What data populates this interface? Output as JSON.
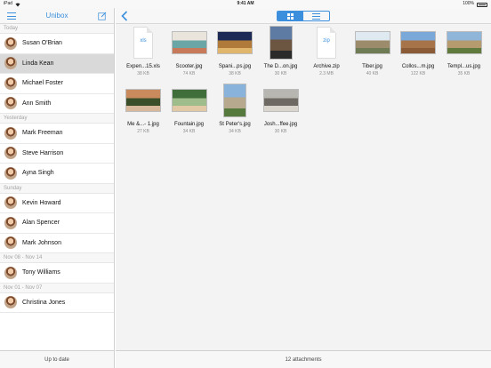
{
  "status_bar": {
    "device": "iPad",
    "time": "9:41 AM",
    "battery": "100%"
  },
  "sidebar": {
    "title": "Unibox",
    "footer": "Up to date",
    "sections": [
      {
        "header": "Today",
        "contacts": [
          {
            "name": "Susan O'Brian",
            "selected": false
          },
          {
            "name": "Linda Kean",
            "selected": true
          },
          {
            "name": "Michael Foster",
            "selected": false
          },
          {
            "name": "Ann Smith",
            "selected": false
          }
        ]
      },
      {
        "header": "Yesterday",
        "contacts": [
          {
            "name": "Mark Freeman",
            "selected": false
          },
          {
            "name": "Steve Harrison",
            "selected": false
          },
          {
            "name": "Ayna Singh",
            "selected": false
          }
        ]
      },
      {
        "header": "Sunday",
        "contacts": [
          {
            "name": "Kevin Howard",
            "selected": false
          },
          {
            "name": "Alan Spencer",
            "selected": false
          },
          {
            "name": "Mark Johnson",
            "selected": false
          }
        ]
      },
      {
        "header": "Nov 08 - Nov 14",
        "contacts": [
          {
            "name": "Tony Williams",
            "selected": false
          }
        ]
      },
      {
        "header": "Nov 01 - Nov 07",
        "contacts": [
          {
            "name": "Christina Jones",
            "selected": false
          }
        ]
      }
    ]
  },
  "main": {
    "view_modes": [
      "grid-icon",
      "list-icon"
    ],
    "active_view": "grid",
    "footer": "12 attachments",
    "accent_color": "#3b8fdc",
    "attachments": [
      {
        "name": "Expen...15.xls",
        "size": "38 KB",
        "kind": "doc",
        "ext": "xls"
      },
      {
        "name": "Scooter.jpg",
        "size": "74 KB",
        "kind": "photo",
        "colors": [
          "#e9e4dc",
          "#6aa6a5",
          "#c77a59"
        ]
      },
      {
        "name": "Spani...ps.jpg",
        "size": "38 KB",
        "kind": "photo",
        "colors": [
          "#1d2a55",
          "#b07a3a",
          "#e0b56c"
        ]
      },
      {
        "name": "The D...on.jpg",
        "size": "30 KB",
        "kind": "photo",
        "colors": [
          "#5e7ca3",
          "#6c5642",
          "#2a2a2a"
        ]
      },
      {
        "name": "Archive.zip",
        "size": "2.3 MB",
        "kind": "doc",
        "ext": "zip"
      },
      {
        "name": "Tiber.jpg",
        "size": "40 KB",
        "kind": "photo",
        "colors": [
          "#dfe9f0",
          "#9c8c6c",
          "#6f7b55"
        ]
      },
      {
        "name": "Collos...m.jpg",
        "size": "122 KB",
        "kind": "photo",
        "colors": [
          "#7aa8d8",
          "#a7744a",
          "#8b5b38"
        ]
      },
      {
        "name": "Templ...us.jpg",
        "size": "35 KB",
        "kind": "photo",
        "colors": [
          "#8fb6d8",
          "#b59b6e",
          "#5f7a3c"
        ]
      },
      {
        "name": "Me &...- 1.jpg",
        "size": "27 KB",
        "kind": "photo",
        "colors": [
          "#c98a5e",
          "#3a4e2a",
          "#d7b89a"
        ]
      },
      {
        "name": "Fountain.jpg",
        "size": "34 KB",
        "kind": "photo",
        "colors": [
          "#3f6e3a",
          "#9fbd8a",
          "#e2c9a6"
        ]
      },
      {
        "name": "St Peter's.jpg",
        "size": "34 KB",
        "kind": "photo",
        "colors": [
          "#8ab3db",
          "#b7a98e",
          "#567a3e"
        ]
      },
      {
        "name": "Josh...ffee.jpg",
        "size": "30 KB",
        "kind": "photo",
        "colors": [
          "#b8b6b0",
          "#6e6a63",
          "#d9d5cd"
        ]
      }
    ]
  }
}
